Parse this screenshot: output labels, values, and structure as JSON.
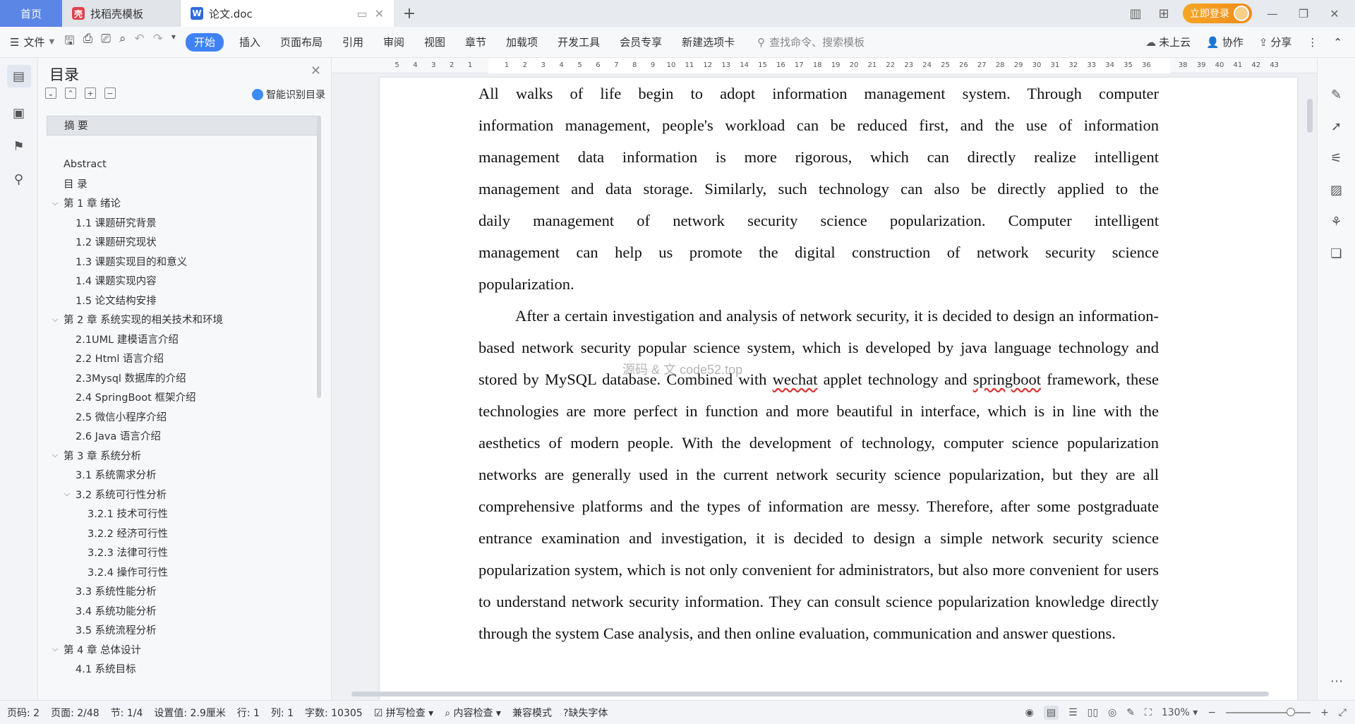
{
  "tabs": {
    "home": "首页",
    "daoke": "找稻壳模板",
    "doc": "论文.doc"
  },
  "topbar": {
    "login": "立即登录"
  },
  "menu": {
    "file": "文件",
    "items": [
      "开始",
      "插入",
      "页面布局",
      "引用",
      "审阅",
      "视图",
      "章节",
      "加载项",
      "开发工具",
      "会员专享",
      "新建选项卡"
    ],
    "search_placeholder": "查找命令、搜索模板",
    "cloud": "未上云",
    "collab": "协作",
    "share": "分享"
  },
  "toc": {
    "title": "目录",
    "smart": "智能识别目录",
    "entries": [
      {
        "label": "摘  要",
        "level": 1,
        "selected": true
      },
      {
        "label": "",
        "level": 1
      },
      {
        "label": "Abstract",
        "level": 1
      },
      {
        "label": "目  录",
        "level": 1
      },
      {
        "label": "第 1 章  绪论",
        "level": 1,
        "expandable": true
      },
      {
        "label": "1.1  课题研究背景",
        "level": 2
      },
      {
        "label": "1.2 课题研究现状",
        "level": 2
      },
      {
        "label": "1.3 课题实现目的和意义",
        "level": 2
      },
      {
        "label": "1.4 课题实现内容",
        "level": 2
      },
      {
        "label": "1.5 论文结构安排",
        "level": 2
      },
      {
        "label": "第 2 章  系统实现的相关技术和环境",
        "level": 1,
        "expandable": true
      },
      {
        "label": "2.1UML 建模语言介绍",
        "level": 2
      },
      {
        "label": "2.2 Html 语言介绍",
        "level": 2
      },
      {
        "label": "2.3Mysql 数据库的介绍",
        "level": 2
      },
      {
        "label": "2.4 SpringBoot 框架介绍",
        "level": 2
      },
      {
        "label": "2.5 微信小程序介绍",
        "level": 2
      },
      {
        "label": "2.6 Java 语言介绍",
        "level": 2
      },
      {
        "label": "第 3 章  系统分析",
        "level": 1,
        "expandable": true
      },
      {
        "label": "3.1 系统需求分析",
        "level": 2
      },
      {
        "label": "3.2 系统可行性分析",
        "level": 2,
        "expandable": true
      },
      {
        "label": "3.2.1 技术可行性",
        "level": 3
      },
      {
        "label": "3.2.2 经济可行性",
        "level": 3
      },
      {
        "label": "3.2.3 法律可行性",
        "level": 3
      },
      {
        "label": "3.2.4 操作可行性",
        "level": 3
      },
      {
        "label": "3.3 系统性能分析",
        "level": 2
      },
      {
        "label": "3.4 系统功能分析",
        "level": 2
      },
      {
        "label": "3.5 系统流程分析",
        "level": 2
      },
      {
        "label": "第 4 章  总体设计",
        "level": 1,
        "expandable": true
      },
      {
        "label": "4.1 系统目标",
        "level": 2
      }
    ]
  },
  "ruler": {
    "left_numbers": [
      "5",
      "4",
      "3",
      "2",
      "1"
    ],
    "right_numbers": [
      "1",
      "2",
      "3",
      "4",
      "5",
      "6",
      "7",
      "8",
      "9",
      "10",
      "11",
      "12",
      "13",
      "14",
      "15",
      "16",
      "17",
      "18",
      "19",
      "20",
      "21",
      "22",
      "23",
      "24",
      "25",
      "26",
      "27",
      "28",
      "29",
      "30",
      "31",
      "32",
      "33",
      "34",
      "35",
      "36",
      "38",
      "39",
      "40",
      "41",
      "42",
      "43"
    ]
  },
  "document": {
    "para1_lines": [
      "All walks of life begin to adopt information management system. Through computer",
      "information management, people's workload can be reduced first, and the use of information",
      "management data information is more rigorous, which can directly realize intelligent",
      "management and data storage. Similarly, such technology can also be directly applied to the",
      "daily management of network security science popularization. Computer intelligent",
      "management can help us promote the digital construction of network security science",
      "popularization."
    ],
    "para2": {
      "before_wechat": "After a certain investigation and analysis of network security, it is decided to design an information-based network security popular science system, which is developed by java language technology and stored by MySQL database. Combined with ",
      "wechat": "wechat",
      "between": " applet technology and ",
      "springboot": "springboot",
      "after_springboot": " framework, these technologies are more perfect in function and more beautiful in interface, which is in line with the aesthetics of modern people. With the development of technology, computer science popularization networks are generally used in the current network security science popularization, but they are all comprehensive platforms and the types of information are messy. Therefore, after some postgraduate entrance examination and investigation, it is decided to design a simple network security science popularization system, which is not only convenient for administrators, but also more convenient for users to understand network security information. They can consult science popularization knowledge directly through the system Case analysis, and then online evaluation, communication and answer questions."
    },
    "watermark": "源码 & 文 code52.top"
  },
  "status": {
    "page_code": "页码: 2",
    "page": "页面: 2/48",
    "section": "节: 1/4",
    "setting": "设置值: 2.9厘米",
    "row": "行: 1",
    "col": "列: 1",
    "words": "字数: 10305",
    "spell": "拼写检查",
    "content": "内容检查",
    "compat": "兼容模式",
    "missing_font": "缺失字体",
    "zoom": "130%"
  }
}
